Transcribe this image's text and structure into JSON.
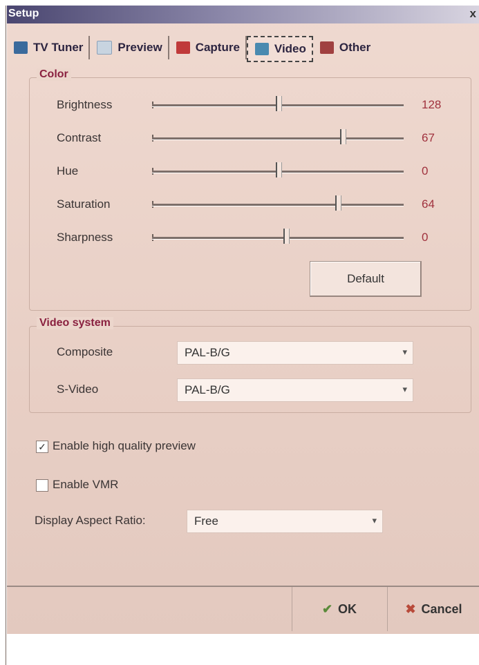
{
  "window": {
    "title": "Setup",
    "close_label": "x"
  },
  "tabs": [
    {
      "label": "TV Tuner",
      "icon": "tv-tuner-icon",
      "color": "#3a6a9c"
    },
    {
      "label": "Preview",
      "icon": "preview-icon",
      "color": "#8aa0b8"
    },
    {
      "label": "Capture",
      "icon": "capture-icon",
      "color": "#c03a3a"
    },
    {
      "label": "Video",
      "icon": "video-icon",
      "color": "#4a8ab0",
      "active": true
    },
    {
      "label": "Other",
      "icon": "other-icon",
      "color": "#a04040"
    }
  ],
  "color_group": {
    "legend": "Color",
    "sliders": [
      {
        "label": "Brightness",
        "value": "128",
        "fraction": 0.5
      },
      {
        "label": "Contrast",
        "value": "67",
        "fraction": 0.76
      },
      {
        "label": "Hue",
        "value": "0",
        "fraction": 0.5
      },
      {
        "label": "Saturation",
        "value": "64",
        "fraction": 0.74
      },
      {
        "label": "Sharpness",
        "value": "0",
        "fraction": 0.53
      }
    ],
    "default_label": "Default"
  },
  "video_system": {
    "legend": "Video system",
    "composite_label": "Composite",
    "composite_value": "PAL-B/G",
    "svideo_label": "S-Video",
    "svideo_value": "PAL-B/G"
  },
  "options": {
    "hq_preview_label": "Enable high quality preview",
    "hq_preview_checked": true,
    "vmr_label": "Enable VMR",
    "vmr_checked": false,
    "aspect_label": "Display Aspect Ratio:",
    "aspect_value": "Free"
  },
  "footer": {
    "ok_label": "OK",
    "cancel_label": "Cancel"
  }
}
